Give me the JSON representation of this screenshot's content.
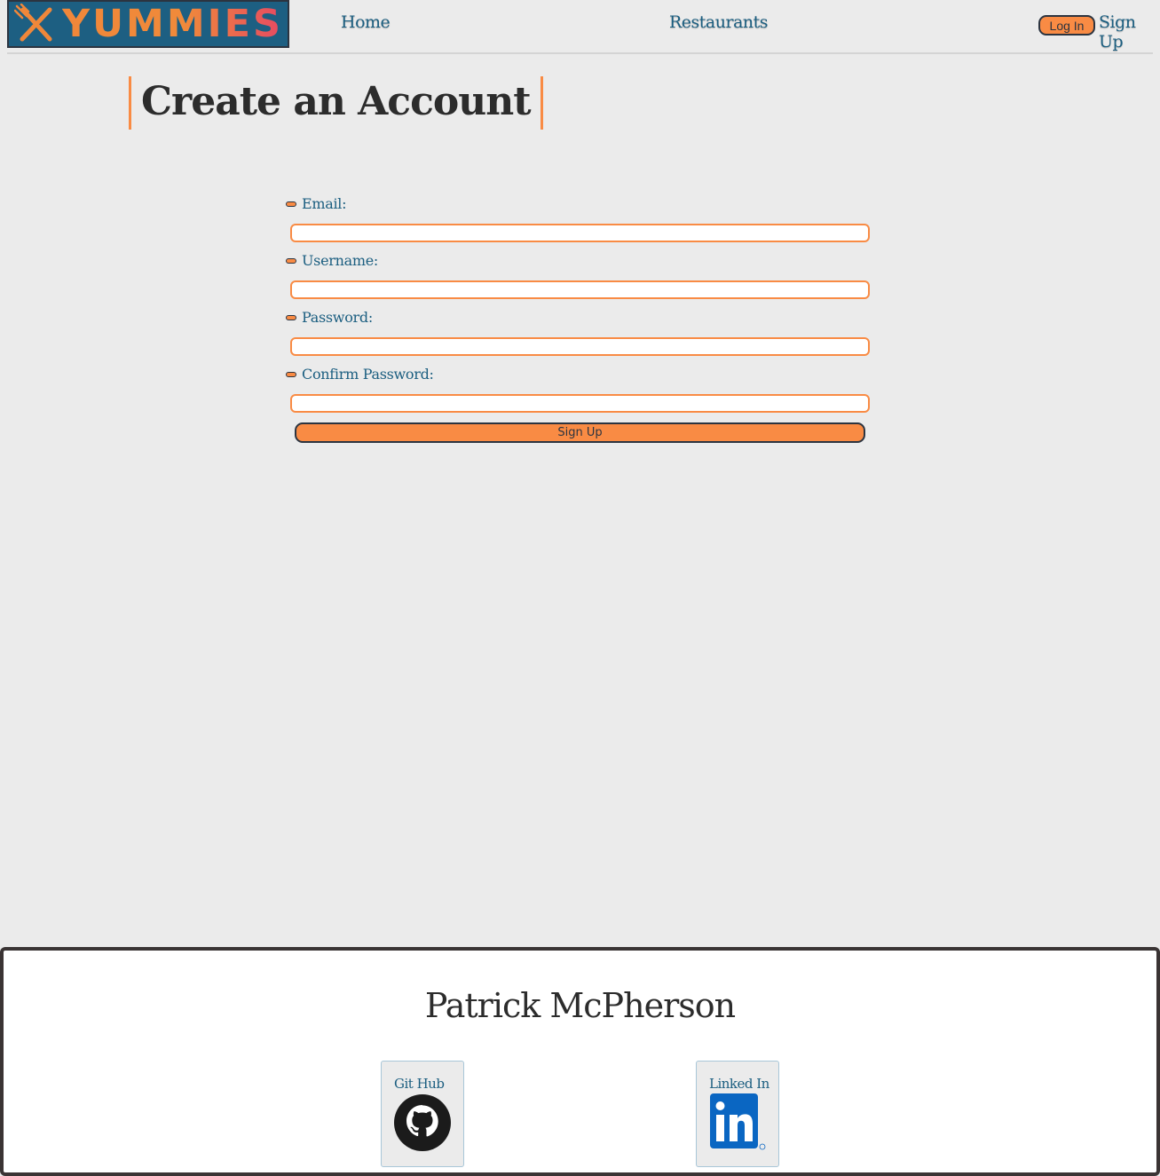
{
  "nav": {
    "logo_text": "YUMMIES",
    "home": "Home",
    "restaurants": "Restaurants",
    "login": "Log In",
    "signup": "Sign Up"
  },
  "page": {
    "title": "Create an Account"
  },
  "form": {
    "email_label": "Email:",
    "email_value": "",
    "username_label": "Username:",
    "username_value": "",
    "password_label": "Password:",
    "password_value": "",
    "confirm_label": "Confirm Password:",
    "confirm_value": "",
    "submit": "Sign Up"
  },
  "footer": {
    "name": "Patrick McPherson",
    "github_label": "Git Hub",
    "github_icon": "github-icon",
    "linkedin_label": "Linked In",
    "linkedin_icon": "linkedin-icon"
  },
  "colors": {
    "accent_orange": "#f98b44",
    "link_blue": "#1b5e80",
    "logo_bg": "#1d5f82",
    "page_bg": "#ebebeb",
    "dark": "#2c3440"
  }
}
